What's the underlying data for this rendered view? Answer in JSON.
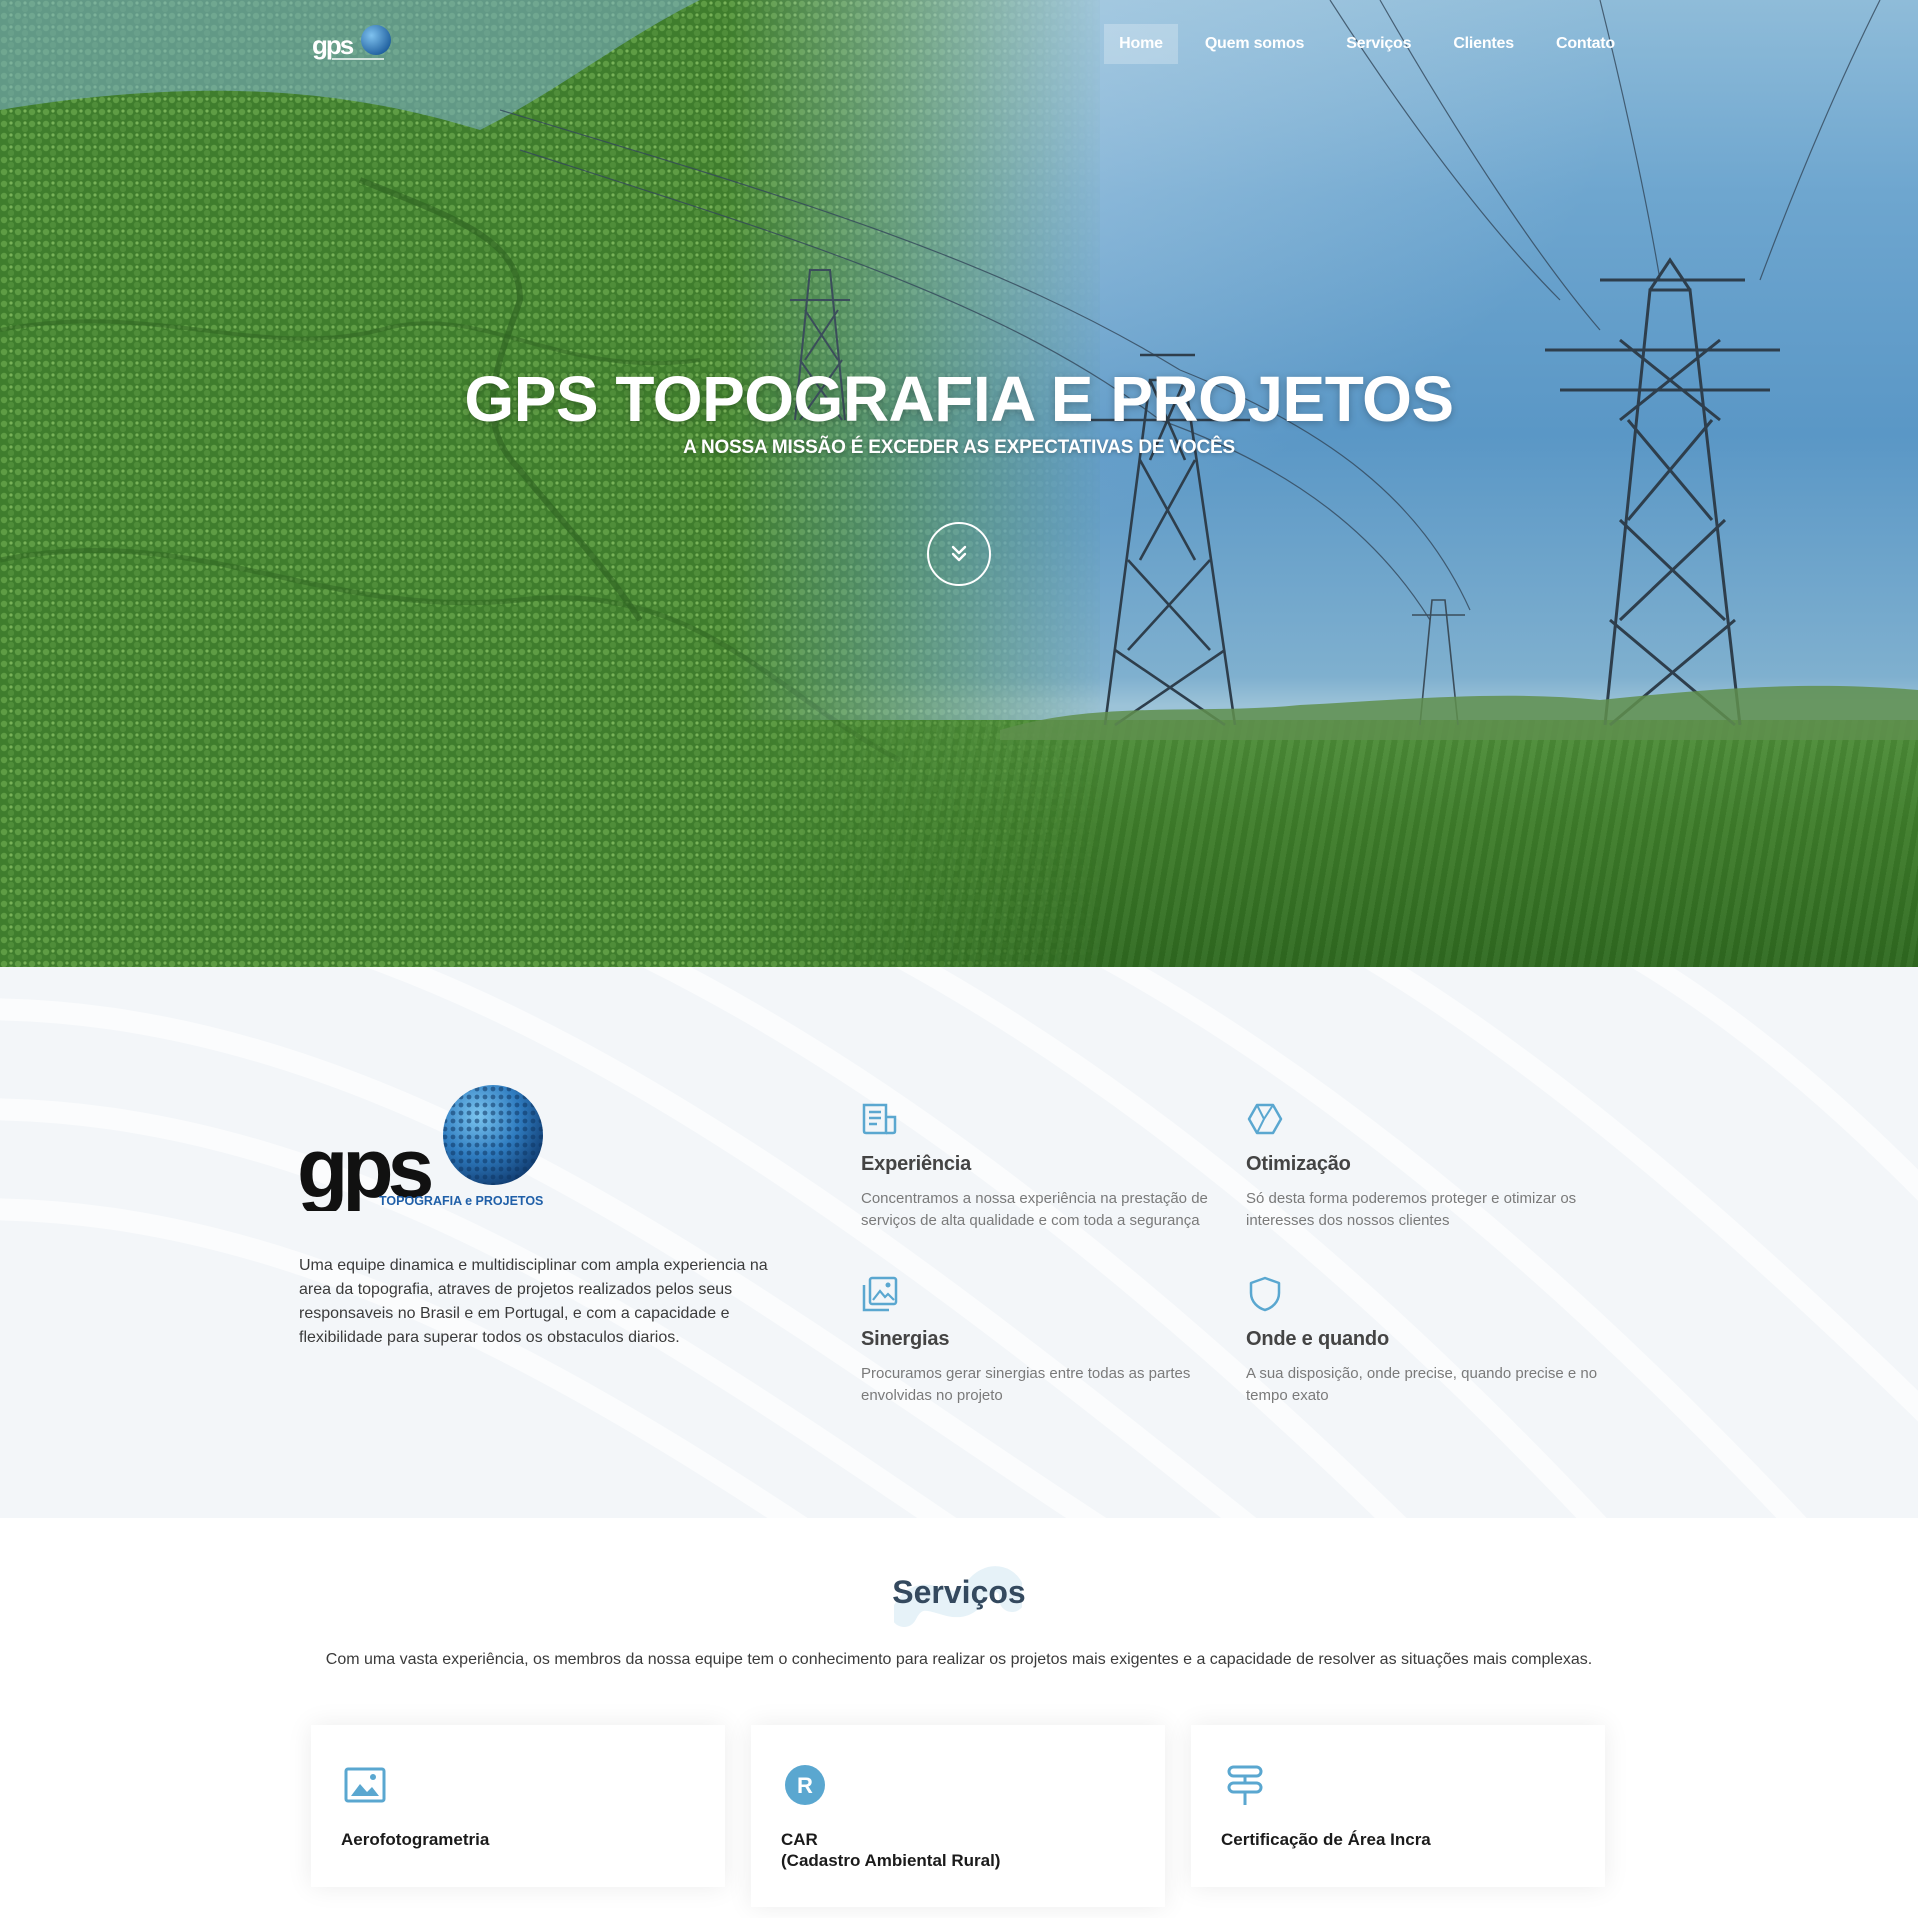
{
  "brand": {
    "logo_wordmark": "gps",
    "logo_tagline": "TOPOGRAFIA e PROJETOS",
    "accent_color": "#5aa7d0",
    "dark_text_color": "#34495e"
  },
  "nav": {
    "items": [
      {
        "label": "Home",
        "active": true
      },
      {
        "label": "Quem somos",
        "active": false
      },
      {
        "label": "Serviços",
        "active": false
      },
      {
        "label": "Clientes",
        "active": false
      },
      {
        "label": "Contato",
        "active": false
      }
    ]
  },
  "hero": {
    "title": "GPS TOPOGRAFIA E PROJETOS",
    "subtitle": "A NOSSA MISSÃO É EXCEDER AS EXPECTATIVAS DE VOCÊS",
    "scroll_icon": "chevron-double-down-icon"
  },
  "about": {
    "text": "Uma equipe dinamica e multidisciplinar com ampla experiencia na area da topografia, atraves de projetos realizados pelos seus responsaveis no Brasil e em Portugal, e com a capacidade e flexibilidade para superar todos os obstaculos diarios.",
    "features": [
      {
        "icon": "document-icon",
        "title": "Experiência",
        "text": "Concentramos a nossa experiência na prestação de serviços de alta qualidade e com toda a segurança"
      },
      {
        "icon": "hexagon-icon",
        "title": "Otimização",
        "text": "Só desta forma poderemos proteger e otimizar os interesses dos nossos clientes"
      },
      {
        "icon": "gallery-icon",
        "title": "Sinergias",
        "text": "Procuramos gerar sinergias entre todas as partes envolvidas no projeto"
      },
      {
        "icon": "shield-icon",
        "title": "Onde e quando",
        "text": "A sua disposição, onde precise, quando precise e no tempo exato"
      }
    ]
  },
  "services": {
    "title": "Serviços",
    "description": "Com uma vasta experiência, os membros da nossa equipe tem o conhecimento para realizar os projetos mais exigentes e a capacidade de resolver as situações mais complexas.",
    "cards": [
      {
        "icon": "image-icon",
        "name": "Aerofotogrametria"
      },
      {
        "icon": "registered-icon",
        "name": "CAR\n(Cadastro Ambiental Rural)"
      },
      {
        "icon": "signpost-icon",
        "name": "Certificação de Área Incra"
      }
    ]
  }
}
